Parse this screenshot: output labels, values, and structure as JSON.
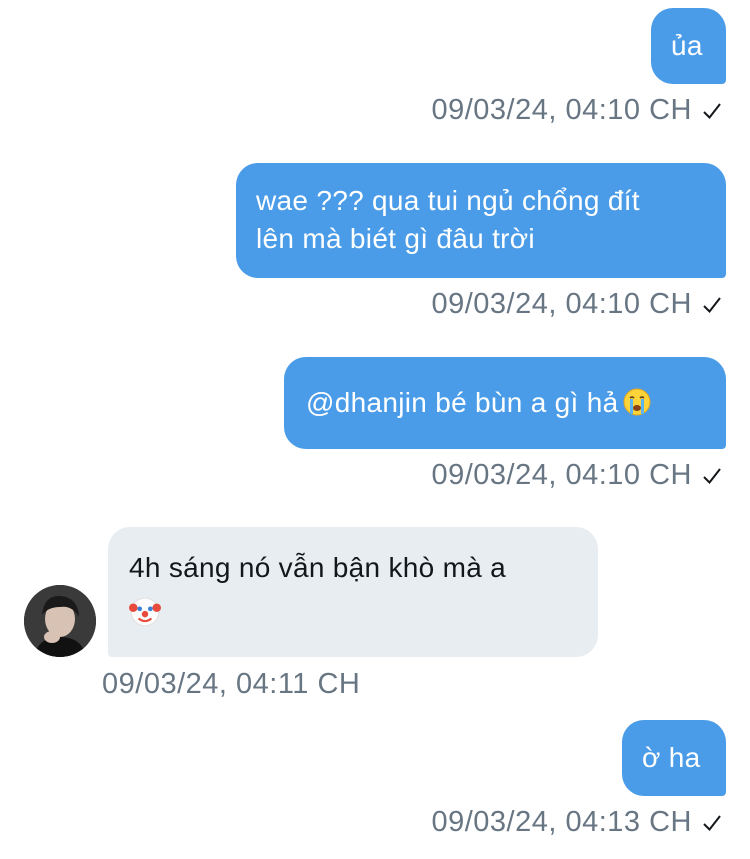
{
  "messages": [
    {
      "text": "ủa",
      "meta": "09/03/24, 04:10 CH"
    },
    {
      "line1": "wae ??? qua tui ngủ chổng đít",
      "line2": "lên mà biét gì đâu trời",
      "meta": "09/03/24, 04:10 CH"
    },
    {
      "text": "@dhanjin bé bùn a gì hả",
      "emoji": "crying-face",
      "meta": "09/03/24, 04:10 CH"
    },
    {
      "line1": "4h sáng nó vẫn bận khò mà a",
      "emoji": "clown-face",
      "meta": "09/03/24, 04:11 CH"
    },
    {
      "text": "ờ ha",
      "meta": "09/03/24, 04:13 CH"
    }
  ],
  "colors": {
    "outgoing_bubble": "#4a9ce8",
    "incoming_bubble": "#e8edf1",
    "timestamp": "#687684",
    "check": "#14171a"
  },
  "icons": {
    "read_receipt": "check-icon",
    "avatar": "user-avatar"
  }
}
